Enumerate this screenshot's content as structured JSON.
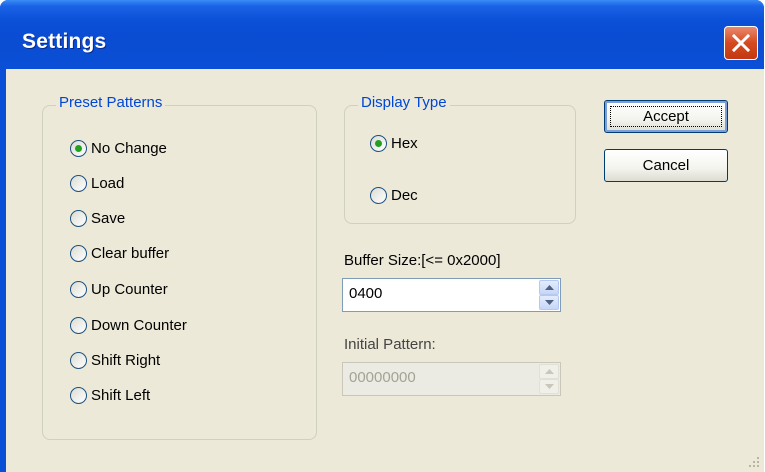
{
  "window": {
    "title": "Settings"
  },
  "preset_patterns": {
    "legend": "Preset Patterns",
    "options": [
      {
        "label": "No Change",
        "checked": true
      },
      {
        "label": "Load",
        "checked": false
      },
      {
        "label": "Save",
        "checked": false
      },
      {
        "label": "Clear buffer",
        "checked": false
      },
      {
        "label": "Up Counter",
        "checked": false
      },
      {
        "label": "Down Counter",
        "checked": false
      },
      {
        "label": "Shift Right",
        "checked": false
      },
      {
        "label": "Shift Left",
        "checked": false
      }
    ]
  },
  "display_type": {
    "legend": "Display Type",
    "options": [
      {
        "label": "Hex",
        "checked": true
      },
      {
        "label": "Dec",
        "checked": false
      }
    ]
  },
  "buttons": {
    "accept": "Accept",
    "cancel": "Cancel"
  },
  "buffer_size": {
    "label": "Buffer Size:[<= 0x2000]",
    "value": "0400"
  },
  "initial_pattern": {
    "label": "Initial Pattern:",
    "value": "00000000",
    "disabled": true
  },
  "colors": {
    "title_bar": "#0a4fd6",
    "dialog_bg": "#ece9d8",
    "legend_text": "#0046d5",
    "radio_dot": "#21a121",
    "close_button": "#d5491f"
  }
}
